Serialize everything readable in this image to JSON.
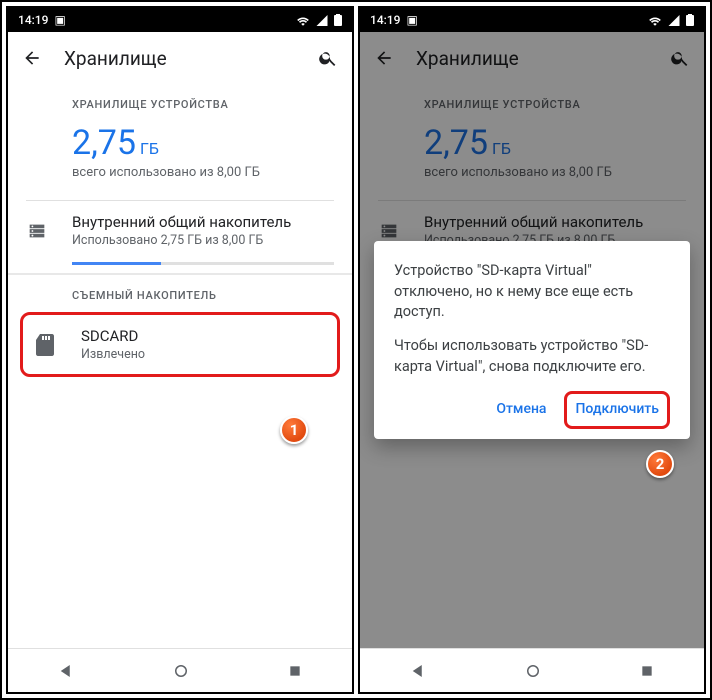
{
  "status": {
    "time": "14:19"
  },
  "header": {
    "title": "Хранилище"
  },
  "device_storage": {
    "label": "ХРАНИЛИЩЕ УСТРОЙСТВА",
    "amount": "2,75",
    "unit": "ГБ",
    "subtitle": "всего использовано из 8,00 ГБ"
  },
  "internal": {
    "title": "Внутренний общий накопитель",
    "subtitle": "Использовано 2,75 ГБ из 8,00 ГБ",
    "progress_pct": 34
  },
  "removable": {
    "label": "СЪЕМНЫЙ НАКОПИТЕЛЬ",
    "item": {
      "title": "SDCARD",
      "subtitle": "Извлечено"
    }
  },
  "dialog": {
    "p1": "Устройство \"SD-карта Virtual\" отключено, но к нему все еще есть доступ.",
    "p2": "Чтобы использовать устройство \"SD-карта Virtual\", снова подключите его.",
    "cancel": "Отмена",
    "confirm": "Подключить"
  },
  "callouts": {
    "one": "1",
    "two": "2"
  }
}
